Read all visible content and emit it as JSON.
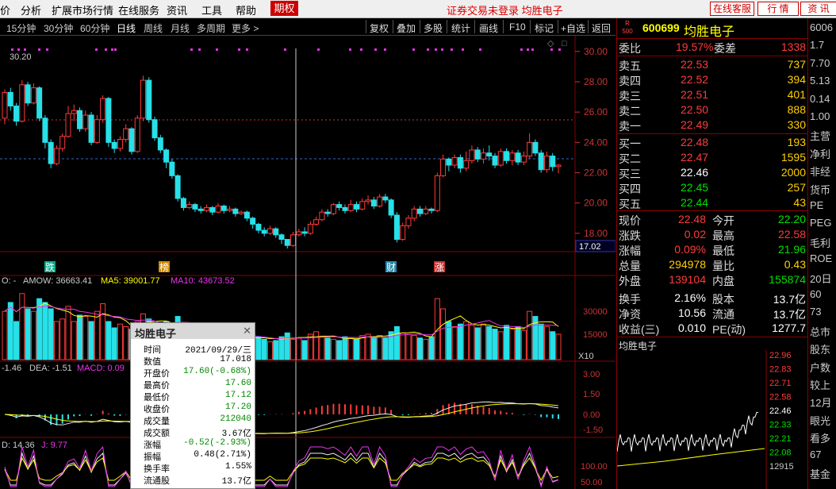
{
  "menu": {
    "items": [
      "价",
      "分析",
      "扩展市场行情",
      "在线服务",
      "资讯",
      "工具",
      "帮助"
    ],
    "qiquan": "期权",
    "notice": "证券交易未登录  均胜电子",
    "online_service": "在线客服",
    "quote": "行  情",
    "info": "资  讯"
  },
  "toolbar": {
    "periods": [
      "15分钟",
      "30分钟",
      "60分钟",
      "日线",
      "周线",
      "月线",
      "多周期",
      "更多 >"
    ],
    "active_period": "日线",
    "tools": [
      "复权",
      "叠加",
      "多股",
      "统计",
      "画线",
      "F10",
      "标记",
      "+自选",
      "返回"
    ]
  },
  "stock": {
    "market_badge_top": "R",
    "market_badge_bottom": "500",
    "code": "600699",
    "name": "均胜电子"
  },
  "orderbook": {
    "weibi_label": "委比",
    "weibi": "19.57%",
    "weicha_label": "委差",
    "weicha": "1338",
    "asks": [
      {
        "label": "卖五",
        "price": "22.53",
        "vol": "737"
      },
      {
        "label": "卖四",
        "price": "22.52",
        "vol": "394"
      },
      {
        "label": "卖三",
        "price": "22.51",
        "vol": "401"
      },
      {
        "label": "卖二",
        "price": "22.50",
        "vol": "888"
      },
      {
        "label": "卖一",
        "price": "22.49",
        "vol": "330"
      }
    ],
    "bids": [
      {
        "label": "买一",
        "price": "22.48",
        "vol": "193",
        "color": "red"
      },
      {
        "label": "买二",
        "price": "22.47",
        "vol": "1595",
        "color": "red"
      },
      {
        "label": "买三",
        "price": "22.46",
        "vol": "2000",
        "color": "white"
      },
      {
        "label": "买四",
        "price": "22.45",
        "vol": "257",
        "color": "green"
      },
      {
        "label": "买五",
        "price": "22.44",
        "vol": "43",
        "color": "green"
      }
    ]
  },
  "stats": [
    {
      "l1": "现价",
      "v1": "22.48",
      "c1": "red",
      "l2": "今开",
      "v2": "22.20",
      "c2": "green"
    },
    {
      "l1": "涨跌",
      "v1": "0.02",
      "c1": "red",
      "l2": "最高",
      "v2": "22.58",
      "c2": "red"
    },
    {
      "l1": "涨幅",
      "v1": "0.09%",
      "c1": "red",
      "l2": "最低",
      "v2": "21.96",
      "c2": "green"
    },
    {
      "l1": "总量",
      "v1": "294978",
      "c1": "yellow",
      "l2": "量比",
      "v2": "0.43",
      "c2": "yellow"
    },
    {
      "l1": "外盘",
      "v1": "139104",
      "c1": "red",
      "l2": "内盘",
      "v2": "155874",
      "c2": "green"
    },
    {
      "l1": "换手",
      "v1": "2.16%",
      "c1": "white",
      "l2": "股本",
      "v2": "13.7亿",
      "c2": "white"
    },
    {
      "l1": "净资",
      "v1": "10.56",
      "c1": "white",
      "l2": "流通",
      "v2": "13.7亿",
      "c2": "white"
    },
    {
      "l1": "收益(三)",
      "v1": "0.010",
      "c1": "white",
      "l2": "PE(动)",
      "v2": "1277.7",
      "c2": "white"
    }
  ],
  "mini_chart": {
    "title": "均胜电子",
    "axis": [
      "22.96",
      "22.83",
      "22.71",
      "22.58",
      "22.46",
      "22.33",
      "22.21",
      "22.08",
      "12915"
    ]
  },
  "far_panel": [
    "6006",
    "1.7",
    "7.70",
    "5.13",
    "0.14",
    "1.00",
    "主营",
    "净利",
    "非经",
    "货币",
    "PE",
    "PEG",
    "毛利",
    "ROE",
    "20日",
    "60",
    "73",
    "总市",
    "股东",
    "户数",
    "较上",
    "12月",
    "眼光",
    "看多",
    "67",
    "基金"
  ],
  "main_chart": {
    "price_label": "30.20",
    "y_ticks": [
      "30.00",
      "28.00",
      "26.00",
      "24.00",
      "22.00",
      "20.00",
      "18.00"
    ],
    "cursor_price": "17.02",
    "events": [
      {
        "label": "跌",
        "color": "#0a8"
      },
      {
        "label": "榜",
        "color": "#c80"
      },
      {
        "label": "财",
        "color": "#28a"
      },
      {
        "label": "涨",
        "color": "#c33"
      }
    ],
    "vol_header": {
      "v0": "O: -",
      "amow": "AMOW: 36663.41",
      "ma5": "MA5: 39001.77",
      "ma10": "MA10: 43673.52"
    },
    "vol_ticks": [
      "30000",
      "15000",
      "X10"
    ],
    "macd_header": {
      "dif": "-1.46",
      "dea": "DEA: -1.51",
      "macd": "MACD: 0.09"
    },
    "macd_ticks": [
      "3.00",
      "1.50",
      "0.00",
      "-1.50"
    ],
    "kdj_header": {
      "d": "D: 14.36",
      "j": "J: 9.77"
    },
    "kdj_ticks": [
      "100.00",
      "50.00"
    ]
  },
  "tooltip": {
    "title": "均胜电子",
    "rows": [
      {
        "k": "时间",
        "v": "2021/09/29/三",
        "c": "#000"
      },
      {
        "k": "数值",
        "v": "17.018",
        "c": "#000"
      },
      {
        "k": "开盘价",
        "v": "17.60(-0.68%)",
        "c": "#080"
      },
      {
        "k": "最高价",
        "v": "17.60",
        "c": "#080"
      },
      {
        "k": "最低价",
        "v": "17.12",
        "c": "#080"
      },
      {
        "k": "收盘价",
        "v": "17.20",
        "c": "#080"
      },
      {
        "k": "成交量",
        "v": "212040",
        "c": "#080"
      },
      {
        "k": "成交额",
        "v": "3.67亿",
        "c": "#000"
      },
      {
        "k": "涨幅",
        "v": "-0.52(-2.93%)",
        "c": "#080"
      },
      {
        "k": "振幅",
        "v": "0.48(2.71%)",
        "c": "#000"
      },
      {
        "k": "换手率",
        "v": "1.55%",
        "c": "#000"
      },
      {
        "k": "流通股",
        "v": "13.7亿",
        "c": "#000"
      }
    ]
  },
  "chart_data": {
    "type": "candlestick",
    "ylim": [
      17,
      30.2
    ],
    "candles": [
      [
        25.6,
        27.3,
        25.2,
        27.5
      ],
      [
        27.3,
        26.4,
        26.1,
        27.6
      ],
      [
        26.4,
        25.4,
        25.1,
        26.6
      ],
      [
        25.4,
        27.8,
        25.3,
        28.1
      ],
      [
        27.8,
        26.6,
        26.4,
        28.0
      ],
      [
        26.6,
        27.6,
        26.5,
        27.9
      ],
      [
        27.6,
        25.6,
        25.4,
        27.7
      ],
      [
        25.6,
        24.0,
        23.6,
        25.8
      ],
      [
        24.0,
        22.6,
        22.3,
        24.2
      ],
      [
        22.6,
        23.6,
        22.5,
        23.8
      ],
      [
        23.6,
        24.4,
        23.4,
        24.6
      ],
      [
        24.4,
        25.9,
        24.3,
        26.4
      ],
      [
        25.9,
        26.1,
        25.4,
        26.5
      ],
      [
        26.1,
        24.9,
        24.7,
        26.3
      ],
      [
        24.9,
        25.8,
        24.7,
        26.1
      ],
      [
        25.8,
        24.0,
        23.8,
        26.0
      ],
      [
        24.0,
        25.5,
        23.9,
        25.8
      ],
      [
        25.5,
        26.9,
        25.3,
        27.1
      ],
      [
        26.9,
        24.0,
        23.7,
        27.0
      ],
      [
        24.0,
        23.6,
        23.3,
        24.2
      ],
      [
        23.6,
        24.2,
        23.4,
        24.4
      ],
      [
        24.2,
        24.9,
        24.0,
        25.2
      ],
      [
        24.9,
        23.4,
        23.2,
        25.0
      ],
      [
        23.4,
        25.6,
        23.3,
        25.8
      ],
      [
        25.6,
        28.1,
        25.4,
        28.4
      ],
      [
        28.1,
        25.5,
        25.3,
        28.3
      ],
      [
        25.5,
        24.3,
        24.1,
        25.7
      ],
      [
        24.3,
        23.5,
        23.3,
        24.5
      ],
      [
        23.5,
        22.7,
        22.3,
        23.6
      ],
      [
        22.7,
        21.8,
        21.6,
        22.9
      ],
      [
        21.8,
        20.3,
        20.1,
        21.9
      ],
      [
        20.3,
        19.7,
        19.5,
        20.4
      ],
      [
        19.7,
        19.9,
        19.6,
        20.1
      ],
      [
        19.9,
        19.6,
        19.4,
        20.0
      ],
      [
        19.6,
        19.5,
        19.3,
        19.8
      ],
      [
        19.5,
        19.7,
        19.4,
        19.9
      ],
      [
        19.7,
        19.4,
        19.2,
        19.8
      ],
      [
        19.4,
        19.8,
        19.3,
        20.0
      ],
      [
        19.8,
        19.5,
        19.3,
        19.9
      ],
      [
        19.5,
        19.6,
        19.4,
        19.8
      ],
      [
        19.6,
        19.3,
        19.1,
        19.7
      ],
      [
        19.3,
        19.4,
        19.2,
        19.5
      ],
      [
        19.4,
        19.0,
        18.8,
        19.5
      ],
      [
        19.0,
        18.6,
        18.3,
        19.1
      ],
      [
        18.6,
        18.2,
        18.0,
        18.7
      ],
      [
        18.2,
        18.0,
        17.8,
        18.4
      ],
      [
        18.0,
        18.3,
        17.9,
        18.5
      ],
      [
        18.3,
        17.9,
        17.7,
        18.4
      ],
      [
        17.9,
        17.6,
        17.3,
        18.0
      ],
      [
        17.6,
        17.2,
        17.0,
        17.6
      ],
      [
        17.2,
        17.9,
        17.1,
        18.1
      ],
      [
        17.9,
        18.1,
        17.8,
        18.3
      ],
      [
        18.1,
        18.0,
        17.8,
        18.4
      ],
      [
        18.0,
        18.6,
        17.9,
        18.8
      ],
      [
        18.6,
        18.9,
        18.5,
        19.1
      ],
      [
        18.9,
        19.4,
        18.8,
        19.6
      ],
      [
        19.4,
        19.3,
        19.1,
        19.6
      ],
      [
        19.3,
        19.9,
        19.2,
        20.0
      ],
      [
        19.9,
        19.7,
        19.5,
        20.1
      ],
      [
        19.7,
        19.5,
        19.3,
        19.9
      ],
      [
        19.5,
        19.9,
        19.4,
        20.2
      ],
      [
        19.9,
        19.6,
        19.4,
        20.1
      ],
      [
        19.6,
        20.1,
        19.5,
        20.3
      ],
      [
        20.1,
        20.2,
        19.9,
        20.5
      ],
      [
        20.2,
        19.8,
        19.6,
        20.4
      ],
      [
        19.8,
        20.4,
        19.7,
        20.6
      ],
      [
        20.4,
        20.2,
        20.0,
        20.6
      ],
      [
        20.2,
        19.2,
        19.0,
        20.3
      ],
      [
        19.2,
        17.6,
        17.4,
        19.4
      ],
      [
        17.6,
        18.5,
        17.5,
        18.7
      ],
      [
        18.5,
        19.0,
        18.3,
        19.2
      ],
      [
        19.0,
        19.6,
        18.8,
        19.8
      ],
      [
        19.6,
        19.3,
        19.1,
        19.8
      ],
      [
        19.3,
        19.6,
        19.2,
        19.8
      ],
      [
        19.6,
        19.5,
        19.3,
        19.7
      ],
      [
        19.5,
        21.8,
        19.4,
        22.0
      ],
      [
        21.8,
        22.9,
        21.7,
        23.2
      ],
      [
        22.9,
        22.5,
        22.1,
        23.0
      ],
      [
        22.5,
        23.0,
        22.3,
        23.2
      ],
      [
        23.0,
        22.3,
        22.0,
        23.2
      ],
      [
        22.3,
        22.8,
        22.1,
        23.4
      ],
      [
        22.8,
        23.5,
        22.6,
        23.8
      ],
      [
        23.5,
        22.9,
        22.7,
        23.7
      ],
      [
        22.9,
        23.3,
        22.6,
        23.6
      ],
      [
        23.3,
        23.1,
        22.8,
        23.8
      ],
      [
        23.1,
        22.5,
        22.3,
        23.3
      ],
      [
        22.5,
        23.4,
        22.4,
        23.6
      ],
      [
        23.4,
        22.8,
        22.6,
        23.6
      ],
      [
        22.8,
        23.3,
        22.5,
        23.5
      ],
      [
        23.3,
        22.7,
        22.5,
        23.5
      ],
      [
        22.7,
        23.1,
        22.5,
        23.4
      ],
      [
        23.1,
        24.0,
        22.9,
        24.6
      ],
      [
        24.0,
        23.3,
        23.1,
        24.2
      ],
      [
        23.3,
        22.2,
        22.0,
        23.5
      ],
      [
        22.2,
        23.1,
        22.0,
        23.4
      ],
      [
        23.1,
        22.4,
        22.1,
        23.3
      ],
      [
        22.4,
        22.5,
        21.96,
        22.58
      ]
    ],
    "volume": [
      38,
      45,
      30,
      52,
      40,
      38,
      48,
      45,
      40,
      30,
      32,
      42,
      30,
      35,
      34,
      30,
      38,
      44,
      30,
      25,
      28,
      26,
      24,
      30,
      36,
      32,
      28,
      26,
      30,
      28,
      34,
      26,
      22,
      20,
      18,
      22,
      19,
      21,
      17,
      18,
      16,
      17,
      15,
      20,
      18,
      16,
      14,
      15,
      18,
      21,
      16,
      17,
      15,
      20,
      22,
      18,
      17,
      16,
      15,
      18,
      17,
      16,
      19,
      20,
      18,
      19,
      17,
      22,
      26,
      21,
      20,
      19,
      17,
      16,
      18,
      48,
      40,
      30,
      26,
      28,
      30,
      27,
      25,
      28,
      26,
      24,
      22,
      27,
      24,
      26,
      23,
      38,
      34,
      28,
      26,
      22,
      20
    ],
    "vol_unit_label": "X10"
  }
}
